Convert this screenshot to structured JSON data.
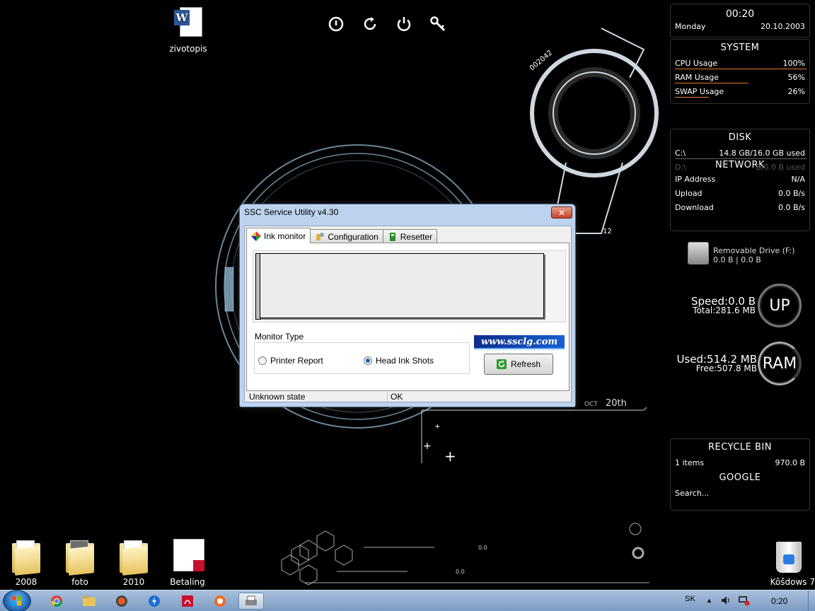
{
  "desktop": {
    "top_icons": [
      {
        "name": "shutdown-icon"
      },
      {
        "name": "restart-icon"
      },
      {
        "name": "power-icon"
      },
      {
        "name": "key-icon"
      }
    ],
    "icons": {
      "zivotopis": "zivotopis",
      "i2008": "2008",
      "foto": "foto",
      "i2010": "2010",
      "betaling": "Betaling",
      "recycle": "Kôšdows 7"
    },
    "deco": {
      "ring_text": "002042",
      "ring_num": "12",
      "date_month": "OCT",
      "date_day": "20th",
      "counter_a": "0.0",
      "counter_b": "0.0"
    }
  },
  "gadgets": {
    "clock": {
      "time": "00:20",
      "day": "Monday",
      "date": "20.10.2003"
    },
    "system": {
      "title": "SYSTEM",
      "rows": [
        {
          "label": "CPU Usage",
          "value": "100%",
          "level": 1.0
        },
        {
          "label": "RAM Usage",
          "value": "56%",
          "level": 0.56
        },
        {
          "label": "SWAP Usage",
          "value": "26%",
          "level": 0.26
        }
      ]
    },
    "disk": {
      "title": "DISK",
      "c_label": "C:\\",
      "c_value": "14.8 GB/16.0 GB used",
      "d_label": "D:\\",
      "d_value": "B/0.0 B used"
    },
    "network": {
      "title": "NETWORK",
      "rows": [
        {
          "label": "IP Address",
          "value": "N/A"
        },
        {
          "label": "Upload",
          "value": "0.0 B/s"
        },
        {
          "label": "Download",
          "value": "0.0 B/s"
        }
      ]
    },
    "removable": {
      "name": "Removable Drive (F:)",
      "usage": "0.0 B |  0.0 B"
    },
    "up": {
      "speed": "Speed:0.0 B",
      "total": "Total:281.6 MB",
      "label": "UP"
    },
    "ram": {
      "used": "Used:514.2 MB",
      "free": "Free:507.8 MB",
      "label": "RAM"
    },
    "recycle": {
      "title": "RECYCLE BIN",
      "items": "1 items",
      "size": "970.0 B"
    },
    "google": {
      "title": "GOOGLE",
      "search": "Search..."
    }
  },
  "window": {
    "title": "SSC Service Utility v4.30",
    "close": "✕",
    "tabs": [
      {
        "label": "Ink monitor",
        "active": true
      },
      {
        "label": "Configuration",
        "active": false
      },
      {
        "label": "Resetter",
        "active": false
      }
    ],
    "monitor_type": "Monitor Type",
    "radio_printer": "Printer Report",
    "radio_head": "Head Ink Shots",
    "selected": "Head Ink Shots",
    "banner": "www.ssclg.com",
    "refresh": "Refresh",
    "status_left": "Unknown state",
    "status_right": "OK"
  },
  "taskbar": {
    "apps": [
      "chrome-icon",
      "explorer-icon",
      "media-icon",
      "thunderbolt-icon",
      "acrobat-icon",
      "avast-icon",
      "printer-utility-icon"
    ],
    "lang": "SK",
    "time": "0:20"
  },
  "colors": {
    "accent_orange": "#e57a2f",
    "window_frame": "#bcd2ee",
    "taskbar": "#8fabce"
  }
}
